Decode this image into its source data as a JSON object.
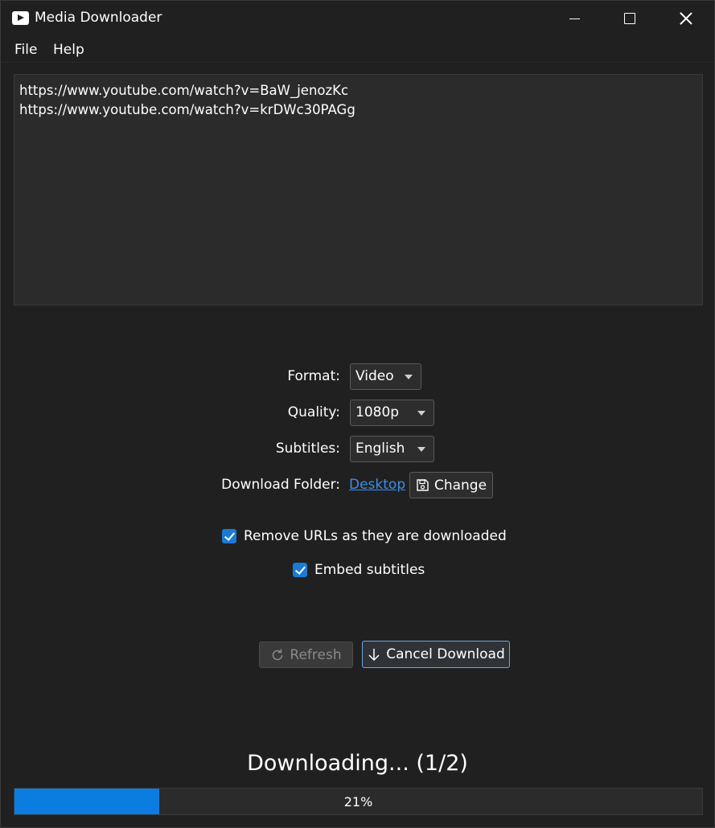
{
  "window": {
    "title": "Media Downloader",
    "icon": "youtube-play-icon"
  },
  "menu": {
    "file": "File",
    "help": "Help"
  },
  "urls": [
    "https://www.youtube.com/watch?v=BaW_jenozKc",
    "https://www.youtube.com/watch?v=krDWc30PAGg"
  ],
  "form": {
    "format_label": "Format:",
    "format_value": "Video",
    "quality_label": "Quality:",
    "quality_value": "1080p",
    "subtitles_label": "Subtitles:",
    "subtitles_value": "English",
    "folder_label": "Download Folder:",
    "folder_value": "Desktop",
    "change_button": "Change",
    "change_icon": "folder-save-icon"
  },
  "options": {
    "remove_urls": {
      "label": "Remove URLs as they are downloaded",
      "checked": true
    },
    "embed_subs": {
      "label": "Embed subtitles",
      "checked": true
    }
  },
  "actions": {
    "refresh": {
      "label": "Refresh",
      "enabled": false,
      "icon": "refresh-icon"
    },
    "cancel": {
      "label": "Cancel Download",
      "enabled": true,
      "icon": "arrow-down-icon"
    }
  },
  "status": {
    "text": "Downloading... (1/2)",
    "progress_percent": 21,
    "progress_label": "21%"
  },
  "colors": {
    "accent": "#0b7de0",
    "link": "#3b8eea",
    "background": "#202020"
  }
}
